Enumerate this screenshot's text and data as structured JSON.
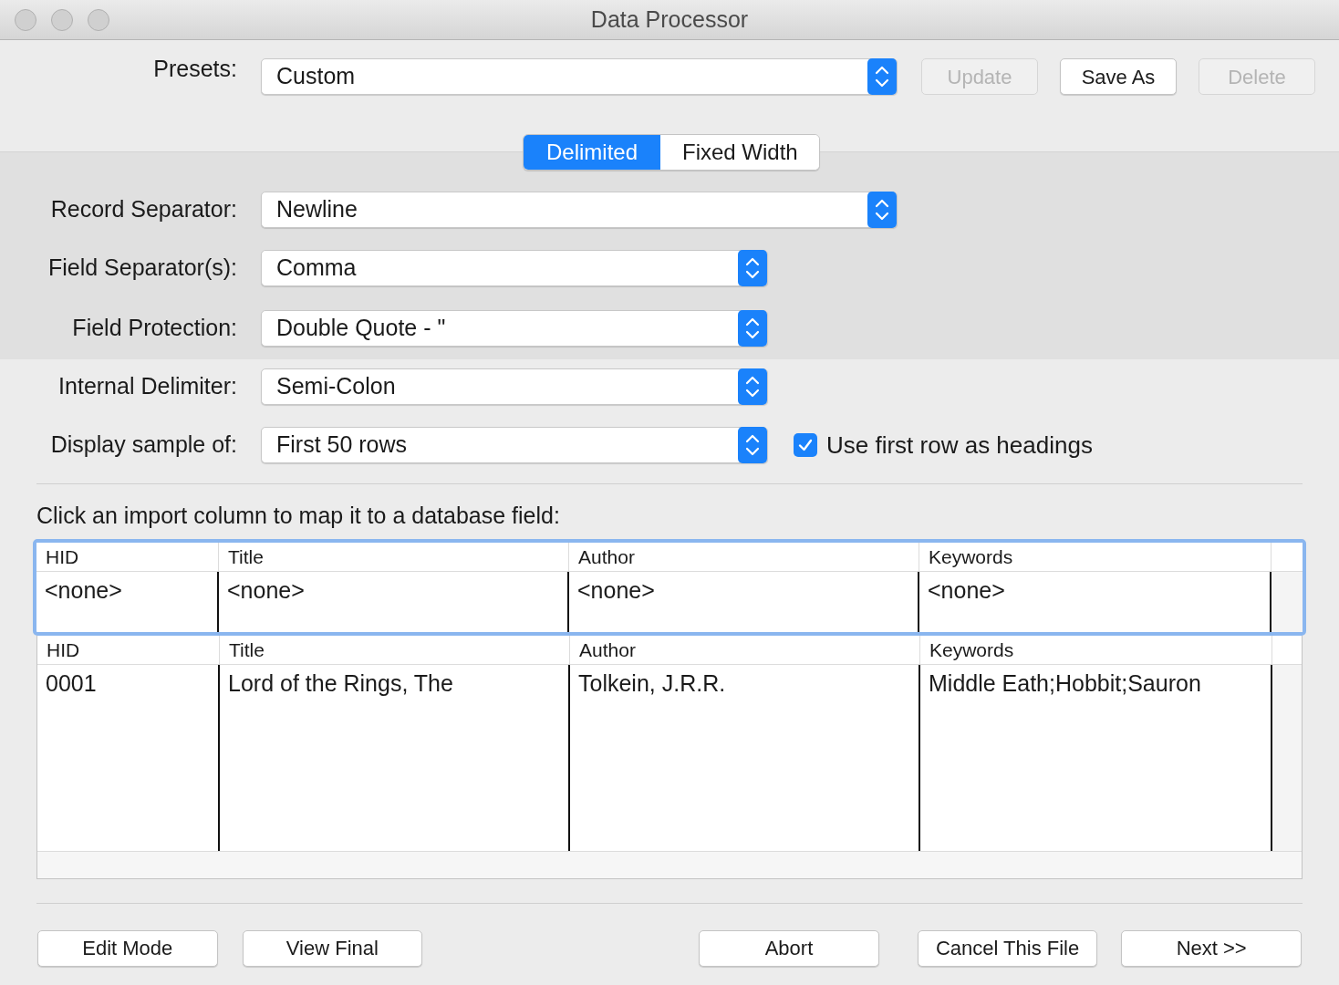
{
  "window": {
    "title": "Data Processor"
  },
  "presets": {
    "label": "Presets:",
    "value": "Custom"
  },
  "preset_buttons": [
    {
      "label": "Update",
      "disabled": true
    },
    {
      "label": "Save As",
      "disabled": false
    },
    {
      "label": "Delete",
      "disabled": true
    }
  ],
  "tabs": [
    {
      "label": "Delimited",
      "selected": true
    },
    {
      "label": "Fixed Width",
      "selected": false
    }
  ],
  "settings": [
    {
      "label": "Record Separator:",
      "value": "Newline"
    },
    {
      "label": "Field Separator(s):",
      "value": "Comma"
    },
    {
      "label": "Field Protection:",
      "value": "Double Quote - \""
    },
    {
      "label": "Internal Delimiter:",
      "value": "Semi-Colon"
    },
    {
      "label": "Display sample of:",
      "value": "First 50 rows"
    }
  ],
  "headings_checkbox": {
    "label": "Use first row as headings",
    "checked": true
  },
  "mapping_prompt": "Click an import column to map it to a database field:",
  "mapping_table": {
    "columns": [
      "HID",
      "Title",
      "Author",
      "Keywords"
    ],
    "cells": [
      "<none>",
      "<none>",
      "<none>",
      "<none>"
    ]
  },
  "sample_table": {
    "columns": [
      "HID",
      "Title",
      "Author",
      "Keywords"
    ],
    "rows": [
      [
        "0001",
        "Lord of the Rings, The",
        "Tolkein, J.R.R.",
        "Middle Eath;Hobbit;Sauron"
      ]
    ]
  },
  "footer_buttons": [
    "Edit Mode",
    "View Final",
    "Abort",
    "Cancel This File",
    "Next >>"
  ]
}
